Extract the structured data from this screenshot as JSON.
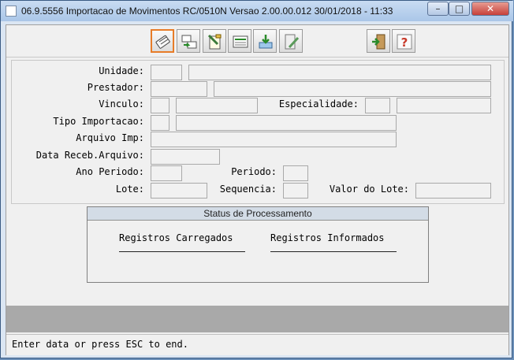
{
  "window": {
    "title": "06.9.5556 Importacao de  Movimentos RC/0510N Versao 2.00.00.012 30/01/2018 - 11:33",
    "controls": {
      "minimize": "–",
      "maximize": "□",
      "close": "✕"
    }
  },
  "toolbar": {
    "buttons": [
      {
        "icon": "confirm-icon"
      },
      {
        "icon": "transfer-icon"
      },
      {
        "icon": "edit-icon"
      },
      {
        "icon": "list-icon"
      },
      {
        "icon": "import-icon"
      },
      {
        "icon": "tools-icon"
      },
      {
        "icon": "exit-icon"
      },
      {
        "icon": "help-icon"
      }
    ]
  },
  "form": {
    "unidade_label": "Unidade:",
    "prestador_label": "Prestador:",
    "vinculo_label": "Vinculo:",
    "especialidade_label": "Especialidade:",
    "tipo_importacao_label": "Tipo Importacao:",
    "arquivo_imp_label": "Arquivo Imp:",
    "data_receb_label": "Data Receb.Arquivo:",
    "ano_periodo_label": "Ano Periodo:",
    "periodo_label": "Periodo:",
    "lote_label": "Lote:",
    "sequencia_label": "Sequencia:",
    "valor_lote_label": "Valor do Lote:"
  },
  "status": {
    "title": "Status de Processamento",
    "col1": "Registros Carregados",
    "col2": "Registros Informados"
  },
  "statusbar": {
    "message": "Enter data or press ESC to end."
  }
}
